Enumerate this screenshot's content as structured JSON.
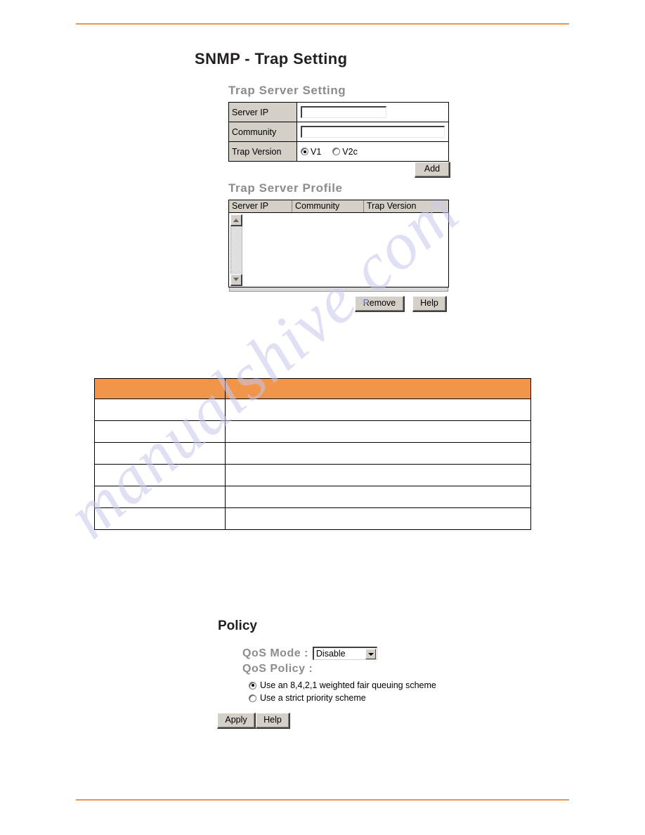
{
  "page": {
    "title": "SNMP - Trap Setting",
    "watermark": "manualshive.com",
    "rule_color": "#e8974a"
  },
  "trap_server_setting": {
    "heading": "Trap Server Setting",
    "rows": {
      "server_ip_label": "Server IP",
      "server_ip_value": "",
      "community_label": "Community",
      "community_value": "",
      "trap_version_label": "Trap Version"
    },
    "trap_version_options": [
      {
        "label": "V1",
        "selected": true
      },
      {
        "label": "V2c",
        "selected": false
      }
    ],
    "add_button": "Add"
  },
  "trap_server_profile": {
    "heading": "Trap Server Profile",
    "columns": [
      "Server IP",
      "Community",
      "Trap Version"
    ],
    "rows": [],
    "remove_button": "Remove",
    "help_button": "Help"
  },
  "description_table": {
    "header_color": "#f0954a",
    "columns": [
      "",
      ""
    ],
    "header": [
      "",
      ""
    ],
    "rows": [
      [
        "",
        ""
      ],
      [
        "",
        ""
      ],
      [
        "",
        ""
      ],
      [
        "",
        ""
      ],
      [
        "",
        ""
      ],
      [
        "",
        ""
      ]
    ]
  },
  "policy": {
    "title": "Policy",
    "qos_mode_label": "QoS Mode :",
    "qos_mode_value": "Disable",
    "qos_policy_label": "QoS Policy :",
    "options": [
      {
        "label": "Use an 8,4,2,1 weighted fair queuing scheme",
        "selected": true
      },
      {
        "label": "Use a strict priority scheme",
        "selected": false
      }
    ],
    "apply_button": "Apply",
    "help_button": "Help"
  }
}
